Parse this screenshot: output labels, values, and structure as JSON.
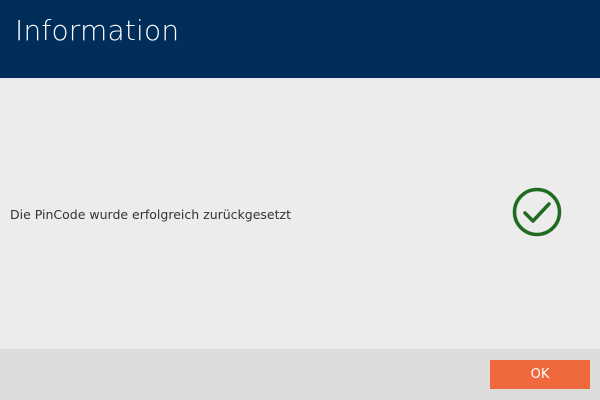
{
  "dialog": {
    "title": "Information",
    "message": "Die PinCode wurde erfolgreich zurückgesetzt",
    "status_icon": "check-circle-icon",
    "ok_label": "OK"
  },
  "colors": {
    "header_bg": "#002d5a",
    "content_bg": "#ececec",
    "footer_bg": "#dcdcdc",
    "accent": "#f0693c",
    "success": "#1f6b1f"
  }
}
